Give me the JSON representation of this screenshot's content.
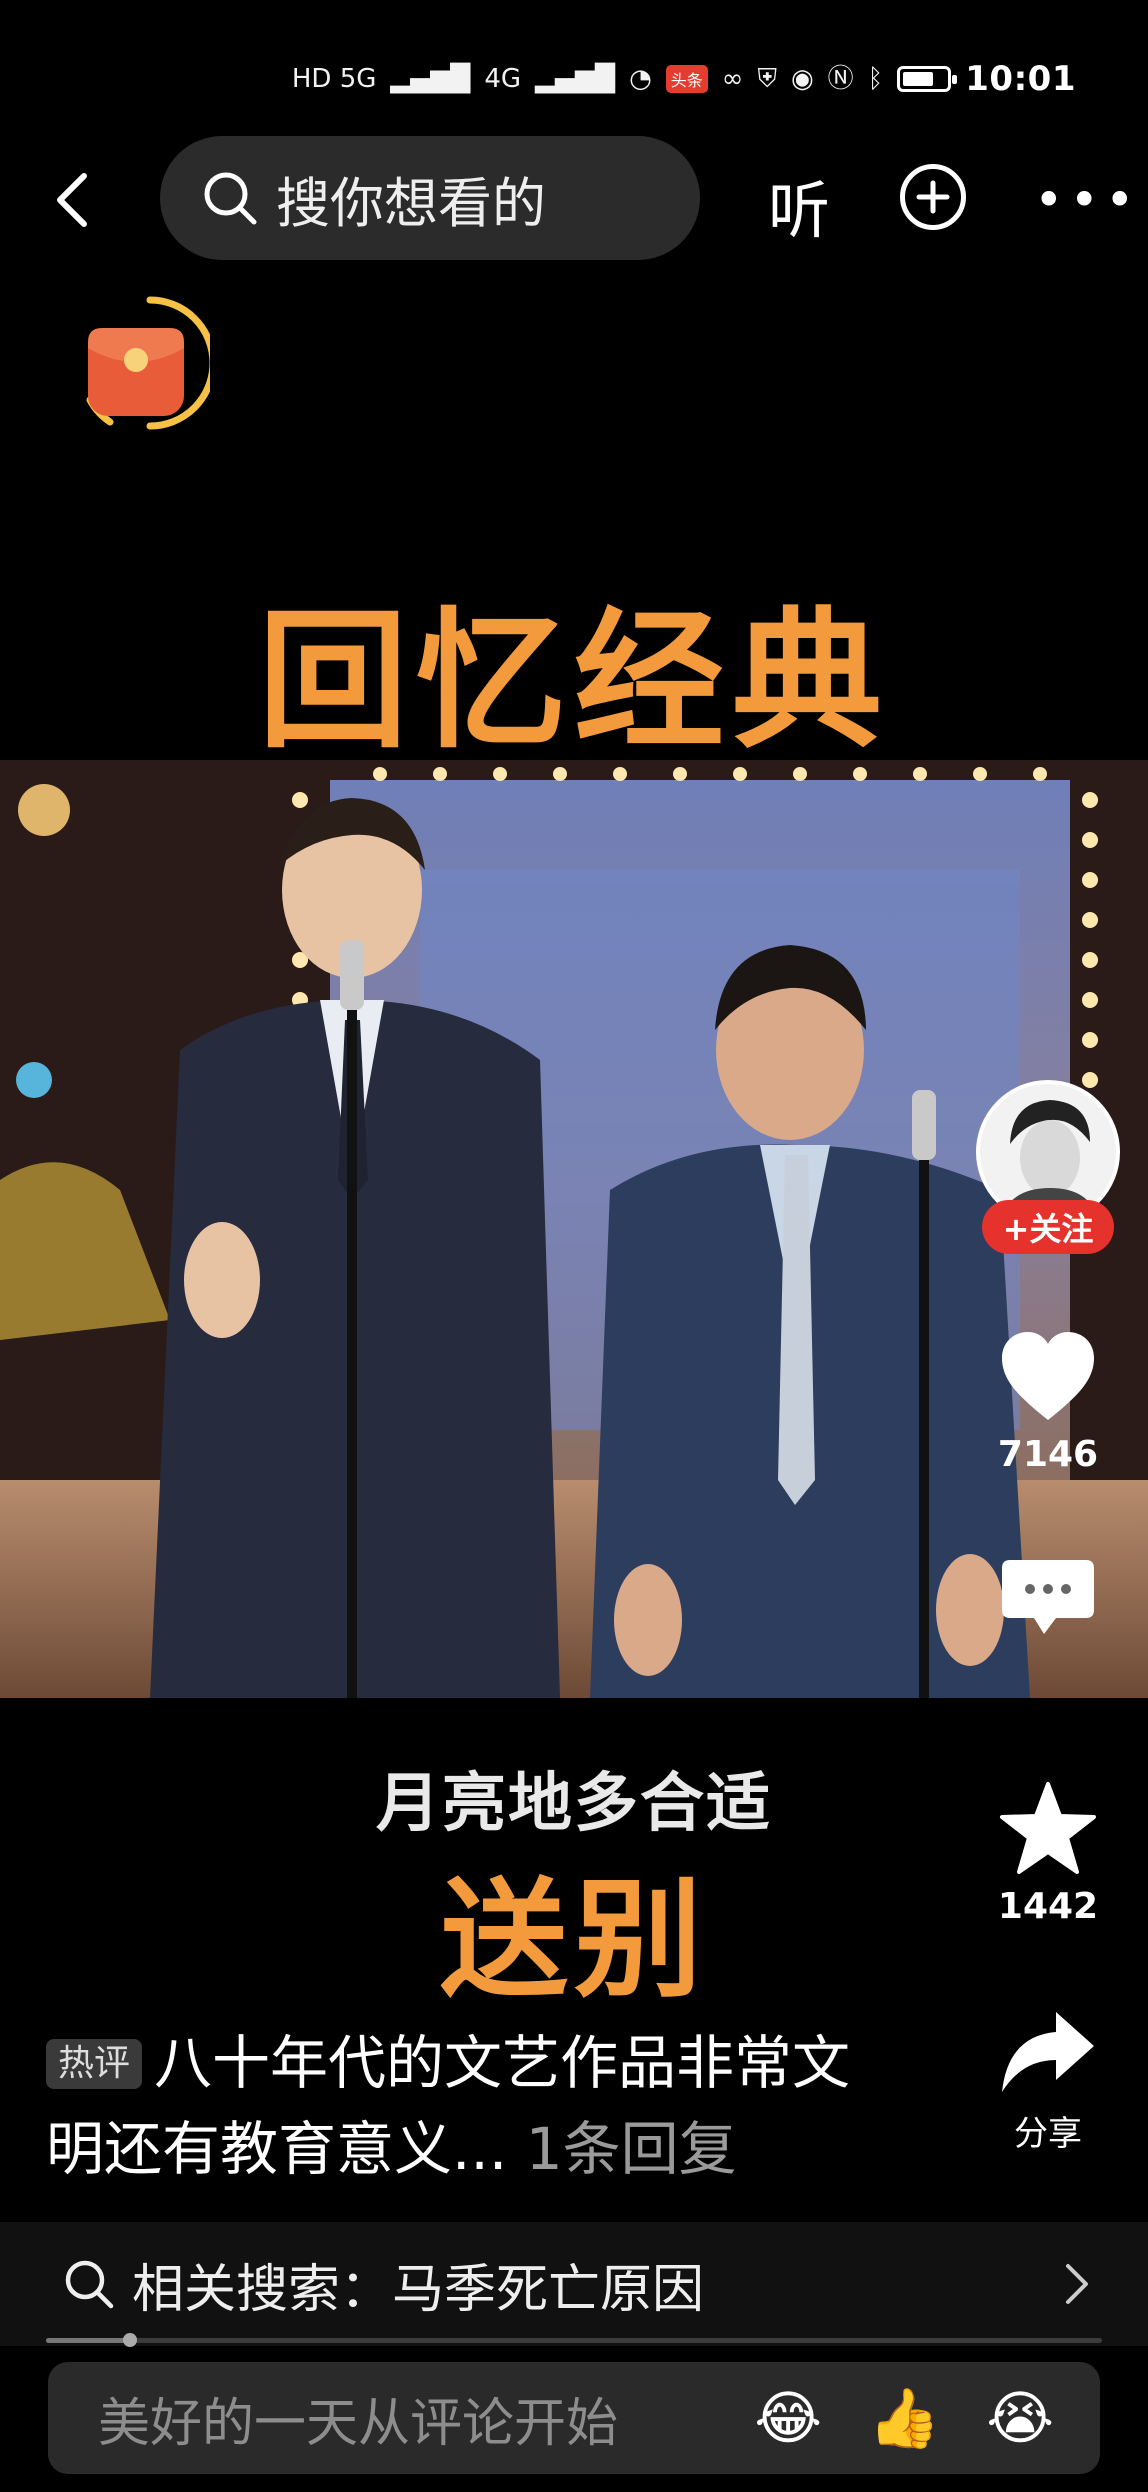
{
  "status_bar": {
    "network_left": "HD 5G",
    "network_right": "4G",
    "app_badge": "头条",
    "battery_level": 0.7,
    "time": "10:01"
  },
  "nav": {
    "search_placeholder": "搜你想看的",
    "listen_label": "听"
  },
  "video": {
    "headline": "回忆经典",
    "subtitle_line1": "月亮地多合适",
    "subtitle_line2": "送别"
  },
  "actions": {
    "follow_label": "+关注",
    "like_count": "7146",
    "comment_count": "",
    "favorite_count": "1442",
    "share_label": "分享"
  },
  "hot_comment": {
    "tag": "热评",
    "text": "八十年代的文艺作品非常文明还有教育意义...",
    "reply": "1条回复"
  },
  "related": {
    "label": "相关搜索：马季死亡原因"
  },
  "progress": {
    "fraction": 0.08
  },
  "comment_bar": {
    "placeholder": "美好的一天从评论开始"
  },
  "colors": {
    "accent_orange": "#f39b3c",
    "follow_red": "#e5322d"
  }
}
